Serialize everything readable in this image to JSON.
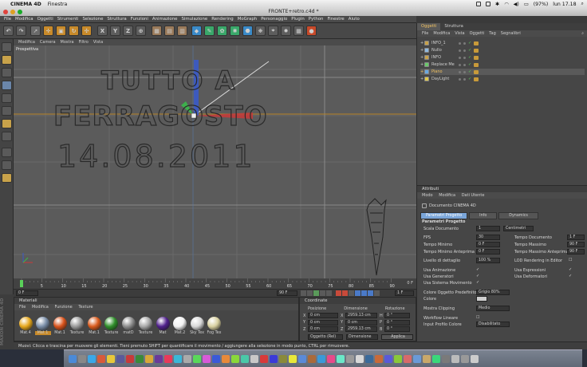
{
  "mac_menubar": {
    "app_name": "CINEMA 4D",
    "menu": "Finestra",
    "battery": "(97%)",
    "clock": "lun 17.18"
  },
  "window": {
    "title": "FRONTE+retro.c4d *"
  },
  "main_menu": [
    "File",
    "Modifica",
    "Oggetti",
    "Strumenti",
    "Selezione",
    "Struttura",
    "Funzioni",
    "Animazione",
    "Simulazione",
    "Rendering",
    "MoGraph",
    "Personaggio",
    "Plugin",
    "Python",
    "Finestre",
    "Aiuto"
  ],
  "toolbar": {
    "axis_x": "X",
    "axis_y": "Y",
    "axis_z": "Z"
  },
  "viewport": {
    "menu": [
      "Modifica",
      "Camera",
      "Mostra",
      "Filtro",
      "Vista"
    ],
    "label": "Prospettiva",
    "text_line1": "TUTTO A",
    "text_line2": "FERRAGOSTO",
    "text_line3": "14.08.2011"
  },
  "timeline": {
    "ticks": [
      "0",
      "5",
      "10",
      "15",
      "20",
      "25",
      "30",
      "35",
      "40",
      "45",
      "50",
      "55",
      "60",
      "65",
      "70",
      "75",
      "80",
      "85",
      "90"
    ],
    "end_frame": "0 F",
    "start_field": "0 F",
    "end_field": "90 F",
    "current_field": "1 F"
  },
  "materials": {
    "title": "Materiali",
    "menu": [
      "File",
      "Modifica",
      "Funzione",
      "Texture"
    ],
    "items": [
      {
        "label": "Mat.4",
        "color": "#e6a81c"
      },
      {
        "label": "Mat.1",
        "color": "#7a8ea8"
      },
      {
        "label": "Mat.1",
        "color": "#d9531c"
      },
      {
        "label": "Texture",
        "color": "#9a9a9a"
      },
      {
        "label": "Mat.1",
        "color": "#d95a1c"
      },
      {
        "label": "Texture",
        "color": "#2f8f2a"
      },
      {
        "label": "matD",
        "color": "#8c8c8c"
      },
      {
        "label": "Texture",
        "color": "#a8a8a8"
      },
      {
        "label": "Mat",
        "color": "#50208c"
      },
      {
        "label": "Mat.2",
        "color": "#f2f2f2"
      },
      {
        "label": "Sky Tex",
        "color": "#d8d8d8"
      },
      {
        "label": "Fog Tex",
        "color": "#d8d0a0"
      }
    ]
  },
  "coordinates": {
    "title": "Coordinate",
    "col_position": "Posizione",
    "col_dimension": "Dimensione",
    "col_rotation": "Rotazione",
    "rows": [
      {
        "axis": "X",
        "pos": "0 cm",
        "dim": "2959.13 cm",
        "rot_axis": "H",
        "rot": "0 °"
      },
      {
        "axis": "Y",
        "pos": "0 cm",
        "dim": "0 cm",
        "rot_axis": "P",
        "rot": "0 °"
      },
      {
        "axis": "Z",
        "pos": "0 cm",
        "dim": "2959.13 cm",
        "rot_axis": "B",
        "rot": "0 °"
      }
    ],
    "mode_select": "Oggetto (Rel)",
    "dim_select": "Dimensione",
    "apply_button": "Applica"
  },
  "status_bar": "Muovi: Clicca e trascina per muovere gli elementi. Tieni premuto SHIFT per quantificare il movimento / aggiungere alla selezione in modo punto, CTRL per rimuovere.",
  "objects_panel": {
    "tabs": [
      "Oggetti",
      "Struttura"
    ],
    "menu": [
      "File",
      "Modifica",
      "Vista",
      "Oggetti",
      "Tag",
      "Segnalibri"
    ],
    "items": [
      {
        "name": "INFO_1",
        "selected": false
      },
      {
        "name": "Nullo",
        "selected": false
      },
      {
        "name": "INFO",
        "selected": false
      },
      {
        "name": "Replace Me",
        "selected": false
      },
      {
        "name": "Piano",
        "selected": true
      },
      {
        "name": "DayLight",
        "selected": false
      }
    ]
  },
  "attributes_panel": {
    "title": "Attributi",
    "menu": [
      "Modo",
      "Modifica",
      "Dati Utente"
    ],
    "doc_title": "Documento CINEMA 4D",
    "subtabs": [
      "Parametri Progetto",
      "Info",
      "Dynamics"
    ],
    "section": "Parametri Progetto",
    "scala_label": "Scala Documento",
    "scala_value": "1",
    "scala_unit": "Centimetri",
    "fps_label": "FPS",
    "fps_value": "30",
    "tempo_doc_label": "Tempo Documento",
    "tempo_doc_value": "1 F",
    "tempo_min_label": "Tempo Minimo",
    "tempo_min_value": "0 F",
    "tempo_max_label": "Tempo Massimo",
    "tempo_max_value": "90 F",
    "tempo_min_ant_label": "Tempo Minimo Anteprima",
    "tempo_min_ant_value": "0 F",
    "tempo_max_ant_label": "Tempo Massimo Anteprima",
    "tempo_max_ant_value": "90 F",
    "livello_label": "Livello di dettaglio",
    "livello_value": "100 %",
    "lod_label": "LOD Rendering in Editor",
    "usa_animazione": "Usa Animazione",
    "usa_espressioni": "Usa Espressioni",
    "usa_generatori": "Usa Generatori",
    "usa_deformatori": "Usa Deformatori",
    "usa_sistema": "Usa Sistema Movimento",
    "colore_pred_label": "Colore Oggetto Predefinito",
    "colore_pred_value": "Grigio 80%",
    "colore_label": "Colore",
    "mostra_clipping_label": "Mostra Clipping",
    "mostra_clipping_value": "Medio",
    "workflow_label": "Workflow Lineare",
    "profilo_label": "Input Profilo Colore",
    "profilo_value": "Disabilitato"
  },
  "logo_strip": "MAXON CINEMA 4D"
}
